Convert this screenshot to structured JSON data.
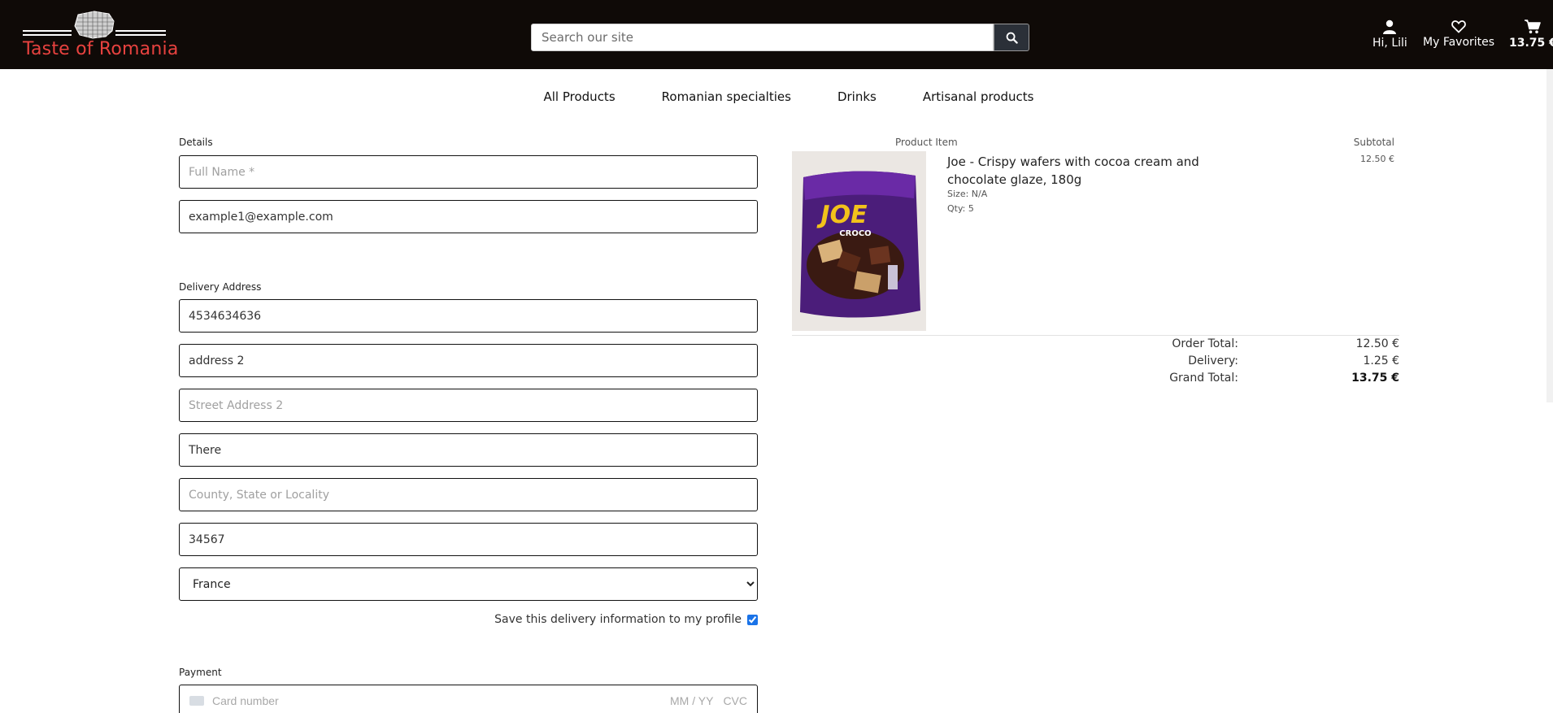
{
  "header": {
    "logo_text": "Taste of Romania",
    "search_placeholder": "Search our site",
    "account_label": "Hi, Lili",
    "favorites_label": "My Favorites",
    "cart_total": "13.75 €"
  },
  "nav": {
    "items": [
      "All Products",
      "Romanian specialties",
      "Drinks",
      "Artisanal products"
    ]
  },
  "details": {
    "section_label": "Details",
    "full_name_placeholder": "Full Name *",
    "email_value": "example1@example.com"
  },
  "delivery": {
    "section_label": "Delivery Address",
    "phone_value": "4534634636",
    "street1_value": "address 2",
    "street2_placeholder": "Street Address 2",
    "town_value": "There",
    "county_placeholder": "County, State or Locality",
    "postcode_value": "34567",
    "country_value": "France",
    "save_label": "Save this delivery information to my profile",
    "save_checked": true
  },
  "payment": {
    "section_label": "Payment",
    "card_placeholder": "Card number",
    "expiry_placeholder": "MM / YY",
    "cvc_placeholder": "CVC"
  },
  "summary": {
    "col_product": "Product Item",
    "col_subtotal": "Subtotal",
    "item": {
      "name": "Joe - Crispy wafers with cocoa cream and chocolate glaze, 180g",
      "size": "Size: N/A",
      "qty": "Qty: 5",
      "subtotal": "12.50 €",
      "image_brand": "JOE",
      "image_sub": "CROCO"
    },
    "order_total_label": "Order Total:",
    "order_total_value": "12.50 €",
    "delivery_label": "Delivery:",
    "delivery_value": "1.25 €",
    "grand_total_label": "Grand Total:",
    "grand_total_value": "13.75 €"
  },
  "colors": {
    "header_bg": "#0f0a07",
    "logo_red": "#e8423f",
    "search_button": "#2b3038"
  }
}
